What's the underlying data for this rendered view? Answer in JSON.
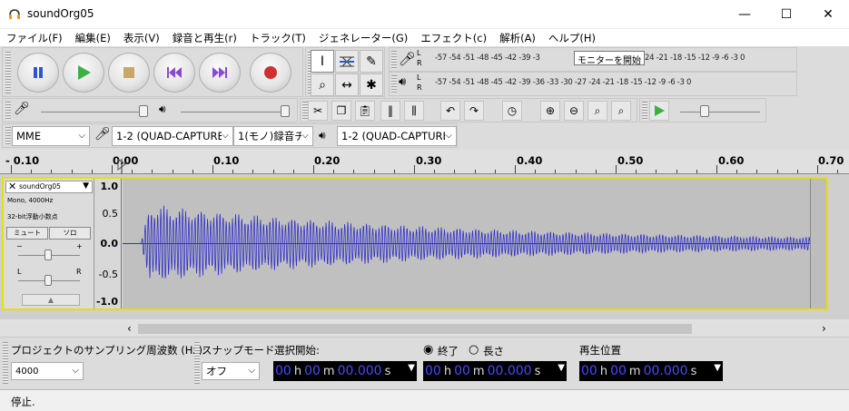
{
  "window": {
    "title": "soundOrg05",
    "minimize": "—",
    "maximize": "☐",
    "close": "✕"
  },
  "menu": [
    "ファイル(F)",
    "編集(E)",
    "表示(V)",
    "録音と再生(r)",
    "トラック(T)",
    "ジェネレーター(G)",
    "エフェクト(c)",
    "解析(A)",
    "ヘルプ(H)"
  ],
  "meters": {
    "record_scale": "-57 -54 -51 -48 -45 -42 -39 -3",
    "record_scale_right": "24 -21 -18 -15 -12  -9   -6  -3  0",
    "monitor_label": "モニターを開始",
    "play_scale": "-57 -54 -51 -48 -45 -42 -39 -36 -33 -30 -27 -24 -21 -18 -15 -12  -9   -6  -3  0",
    "channel_l": "L",
    "channel_r": "R"
  },
  "devices": {
    "host": "MME",
    "recording_device": "1-2 (QUAD-CAPTURE",
    "channels": "1(モノ)録音チ",
    "playback_device": "1-2 (QUAD-CAPTURE"
  },
  "ruler": {
    "labels": [
      "- 0.10",
      "0.00",
      "0.10",
      "0.20",
      "0.30",
      "0.40",
      "0.50",
      "0.60",
      "0.70"
    ]
  },
  "track": {
    "name": "soundOrg05",
    "info1": "Mono, 4000Hz",
    "info2": "32-bit浮動小数点",
    "mute": "ミュート",
    "solo": "ソロ",
    "gain_minus": "−",
    "gain_plus": "+",
    "pan_l": "L",
    "pan_r": "R",
    "scale": [
      "1.0",
      "0.5",
      "0.0",
      "-0.5",
      "-1.0"
    ],
    "wave_color": "#3232c8"
  },
  "selection": {
    "rate_label": "プロジェクトのサンプリング周波数 (Hz):",
    "rate_value": "4000",
    "snap_label": "スナップモード",
    "snap_value": "オフ",
    "start_label": "選択開始:",
    "end_label": "終了",
    "length_label": "長さ",
    "pos_label": "再生位置",
    "time_h": "00",
    "time_m": "00",
    "time_s": "00.000",
    "unit_h": "h",
    "unit_m": "m",
    "unit_s": "s"
  },
  "status": {
    "text": "停止."
  }
}
